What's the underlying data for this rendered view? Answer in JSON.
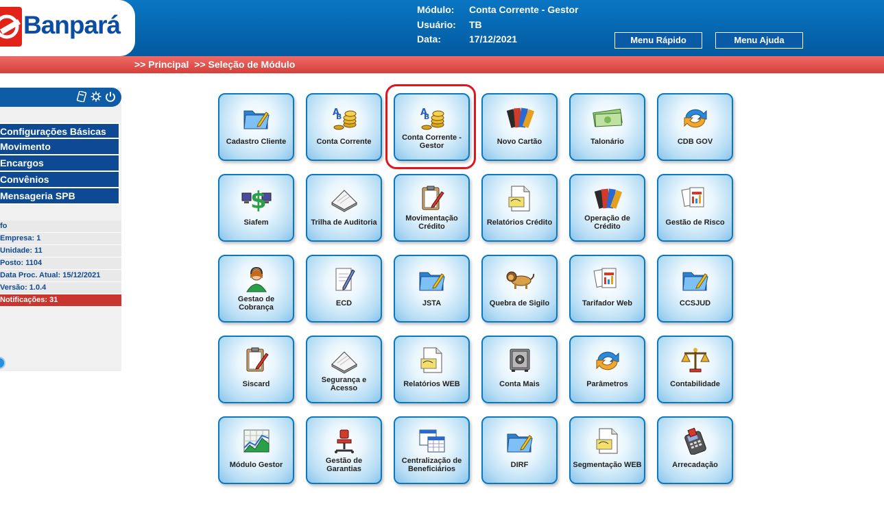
{
  "brand": {
    "name": "Banpará"
  },
  "header": {
    "modulo_label": "Módulo:",
    "modulo_value": "Conta Corrente - Gestor",
    "usuario_label": "Usuário:",
    "usuario_value": "TB",
    "data_label": "Data:",
    "data_value": "17/12/2021",
    "menu_rapido": "Menu Rápido",
    "menu_ajuda": "Menu Ajuda"
  },
  "breadcrumb": {
    "items": [
      ">> Principal",
      ">> Seleção de Módulo"
    ]
  },
  "sidebar": {
    "menu": [
      "Configurações Básicas",
      "Movimento",
      "Encargos",
      "Convênios",
      "Mensageria SPB"
    ],
    "info": [
      "fo",
      "Empresa: 1",
      "Unidade: 11",
      "Posto: 1104",
      "Data Proc. Atual: 15/12/2021",
      "Versão: 1.0.4",
      "Notificações: 31"
    ]
  },
  "modules": [
    {
      "label": "Cadastro Cliente",
      "icon": "folder-icon"
    },
    {
      "label": "Conta Corrente",
      "icon": "coins-icon"
    },
    {
      "label": "Conta Corrente - Gestor",
      "icon": "coins-icon"
    },
    {
      "label": "Novo Cartão",
      "icon": "cards-icon"
    },
    {
      "label": "Talonário",
      "icon": "money-icon"
    },
    {
      "label": "CDB GOV",
      "icon": "sync-icon"
    },
    {
      "label": "Siafem",
      "icon": "dollar-computers-icon"
    },
    {
      "label": "Trilha de Auditoria",
      "icon": "papers-icon"
    },
    {
      "label": "Movimentação Crédito",
      "icon": "clipboard-pen-icon"
    },
    {
      "label": "Relatórios Crédito",
      "icon": "document-icon"
    },
    {
      "label": "Operação de Crédito",
      "icon": "cards-icon"
    },
    {
      "label": "Gestão de Risco",
      "icon": "reports-icon"
    },
    {
      "label": "Gestao de Cobrança",
      "icon": "operator-icon"
    },
    {
      "label": "ECD",
      "icon": "pen-paper-icon"
    },
    {
      "label": "JSTA",
      "icon": "folder-icon"
    },
    {
      "label": "Quebra de Sigilo",
      "icon": "lion-icon"
    },
    {
      "label": "Tarifador Web",
      "icon": "reports-icon"
    },
    {
      "label": "CCSJUD",
      "icon": "folder-icon"
    },
    {
      "label": "Siscard",
      "icon": "clipboard-pen-icon"
    },
    {
      "label": "Segurança e Acesso",
      "icon": "papers-icon"
    },
    {
      "label": "Relatórios WEB",
      "icon": "document-icon"
    },
    {
      "label": "Conta Mais",
      "icon": "safe-icon"
    },
    {
      "label": "Parâmetros",
      "icon": "sync-icon"
    },
    {
      "label": "Contabilidade",
      "icon": "scale-icon"
    },
    {
      "label": "Módulo Gestor",
      "icon": "chart-icon"
    },
    {
      "label": "Gestão de Garantias",
      "icon": "chair-icon"
    },
    {
      "label": "Centralização de Beneficiários",
      "icon": "table-icon"
    },
    {
      "label": "DIRF",
      "icon": "folder-icon"
    },
    {
      "label": "Segmentação WEB",
      "icon": "document-icon"
    },
    {
      "label": "Arrecadação",
      "icon": "card-machine-icon"
    }
  ],
  "colors": {
    "header_blue": "#0565ad",
    "breadcrumb_red": "#d63f3a",
    "highlight": "#e0141c",
    "tile_border": "#0b78be"
  }
}
